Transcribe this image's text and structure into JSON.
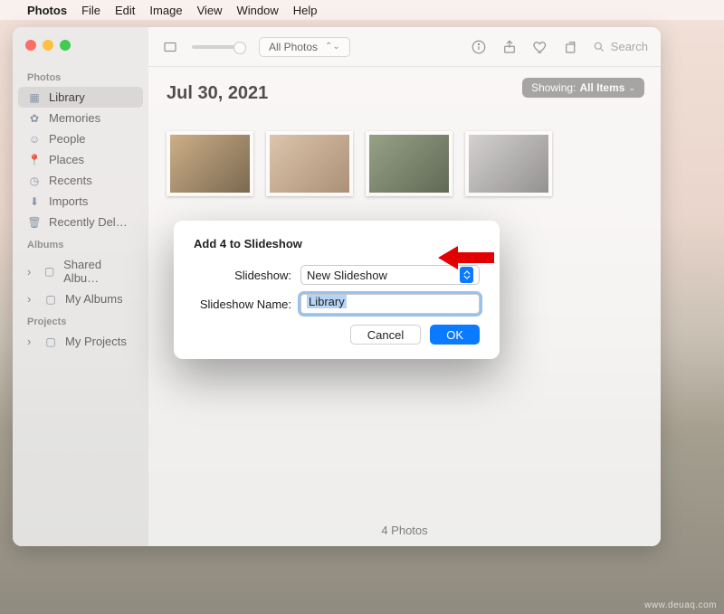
{
  "menubar": {
    "app": "Photos",
    "items": [
      "File",
      "Edit",
      "Image",
      "View",
      "Window",
      "Help"
    ]
  },
  "sidebar": {
    "sections": {
      "photos": {
        "label": "Photos",
        "items": [
          "Library",
          "Memories",
          "People",
          "Places",
          "Recents",
          "Imports",
          "Recently Del…"
        ]
      },
      "albums": {
        "label": "Albums",
        "items": [
          "Shared Albu…",
          "My Albums"
        ]
      },
      "projects": {
        "label": "Projects",
        "items": [
          "My Projects"
        ]
      }
    },
    "selected": "Library"
  },
  "toolbar": {
    "filter_label": "All Photos",
    "search_placeholder": "Search"
  },
  "content": {
    "date_heading": "Jul 30, 2021",
    "showing_prefix": "Showing:",
    "showing_value": "All Items",
    "footer": "4 Photos"
  },
  "dialog": {
    "title": "Add 4 to Slideshow",
    "slideshow_label": "Slideshow:",
    "slideshow_value": "New Slideshow",
    "name_label": "Slideshow Name:",
    "name_value": "Library",
    "cancel": "Cancel",
    "ok": "OK"
  },
  "watermark": "www.deuaq.com"
}
